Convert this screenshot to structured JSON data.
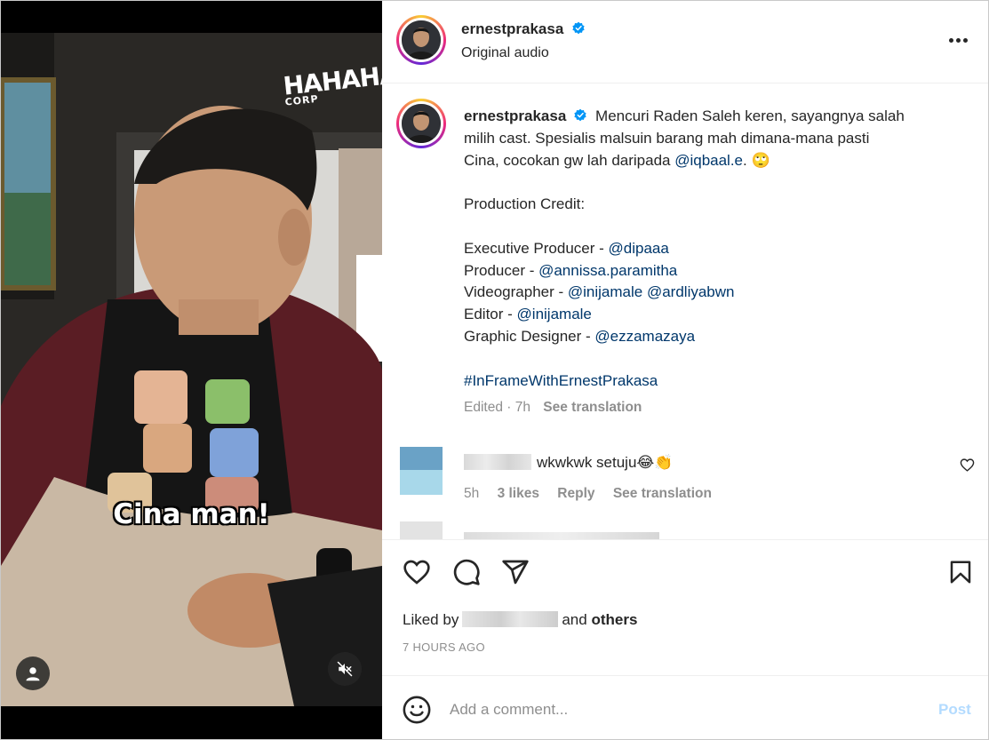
{
  "video": {
    "logo_main": "HAHAHA",
    "logo_sub": "CORP",
    "subtitle": "Cina man!"
  },
  "post": {
    "username": "ernestprakasa",
    "audio": "Original audio",
    "caption": {
      "username": "ernestprakasa",
      "line1": "Mencuri Raden Saleh keren, sayangnya salah",
      "line2": "milih cast. Spesialis malsuin barang mah dimana-mana pasti",
      "line3_a": "Cina, cocokan gw lah daripada ",
      "line3_mention": "@iqbaal.e",
      "line3_b": ". 🙄",
      "credit_title": "Production Credit:",
      "exec_label": "Executive Producer - ",
      "exec_handle": "@dipaaa",
      "prod_label": "Producer - ",
      "prod_handle": "@annissa.paramitha",
      "video_label": "Videographer - ",
      "video_handle1": "@inijamale",
      "video_handle2": "@ardliyabwn",
      "editor_label": "Editor - ",
      "editor_handle": "@inijamale",
      "graphic_label": "Graphic Designer - ",
      "graphic_handle": "@ezzamazaya",
      "hashtag": "#InFrameWithErnestPrakasa"
    },
    "meta": {
      "edited": "Edited · 7h",
      "see_translation": "See translation"
    },
    "comments": [
      {
        "text": "wkwkwk setuju😂👏",
        "time": "5h",
        "likes": "3 likes",
        "reply": "Reply",
        "see_translation": "See translation"
      }
    ],
    "liked_by": {
      "prefix": "Liked by",
      "suffix": "and",
      "others": "others"
    },
    "timestamp": "7 HOURS AGO",
    "add_comment_placeholder": "Add a comment...",
    "post_label": "Post"
  },
  "colors": {
    "accent": "#0095f6",
    "mention": "#00376b",
    "muted": "#8e8e8e",
    "post_disabled": "#b3dbff"
  }
}
